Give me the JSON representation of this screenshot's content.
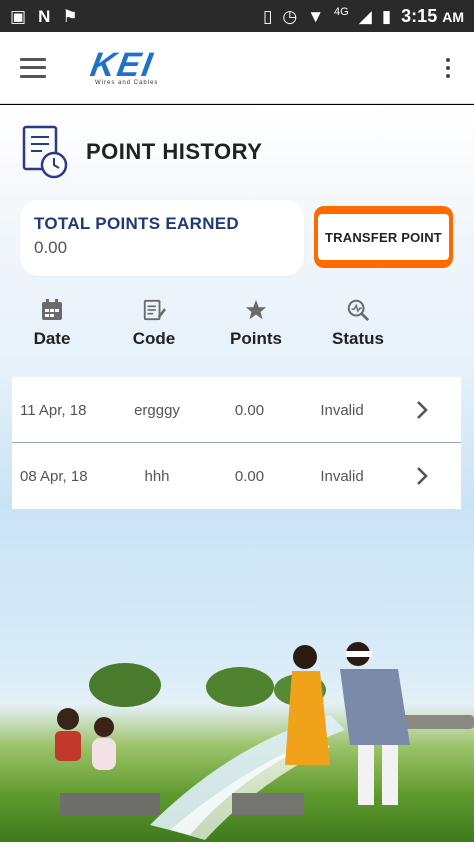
{
  "status_bar": {
    "left_icons": [
      "image-icon",
      "n-icon",
      "flag-icon"
    ],
    "right_icons": [
      "vibrate-icon",
      "alarm-icon",
      "wifi-icon",
      "signal-icon",
      "battery-icon"
    ],
    "network": "4G",
    "time": "3:15",
    "ampm": "AM"
  },
  "app_bar": {
    "logo_text": "KEI",
    "logo_tagline": "Wires and Cables"
  },
  "page": {
    "title": "POINT HISTORY"
  },
  "summary": {
    "label": "TOTAL POINTS EARNED",
    "value": "0.00",
    "transfer_button": "TRANSFER POINT"
  },
  "columns": [
    {
      "label": "Date",
      "icon": "calendar-icon"
    },
    {
      "label": "Code",
      "icon": "edit-note-icon"
    },
    {
      "label": "Points",
      "icon": "star-icon"
    },
    {
      "label": "Status",
      "icon": "search-analytics-icon"
    }
  ],
  "rows": [
    {
      "date": "11 Apr, 18",
      "code": "ergggy",
      "points": "0.00",
      "status": "Invalid"
    },
    {
      "date": "08 Apr, 18",
      "code": "hhh",
      "points": "0.00",
      "status": "Invalid"
    }
  ],
  "colors": {
    "accent_orange": "#ff6a00",
    "title_blue": "#1e3a7a",
    "logo_blue": "#1e73c8"
  }
}
